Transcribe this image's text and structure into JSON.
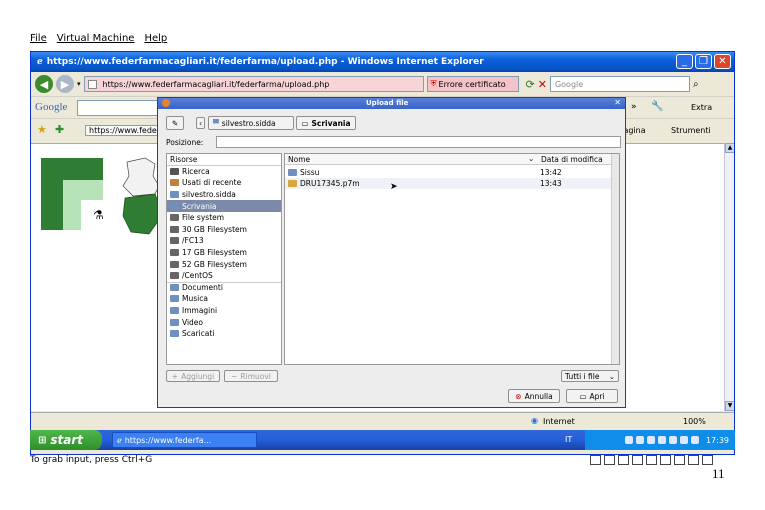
{
  "vm_menu": [
    "File",
    "Virtual Machine",
    "Help"
  ],
  "ie": {
    "title": "https://www.federfarmacagliari.it/federfarma/upload.php - Windows Internet Explorer",
    "address": "https://www.federfarmacagliari.it/federfarma/upload.php",
    "cert_error": "Errore certificato",
    "search_placeholder": "Google",
    "google_label": "Google",
    "tools_label": "Pagina",
    "tools2_label": "Strumenti",
    "extra_label": "Extra",
    "fav_tab": "https://www.fede...",
    "status_internet": "Internet",
    "zoom": "100%"
  },
  "dialog": {
    "title": "Upload file",
    "path_parent": "silvestro.sidda",
    "path_current": "Scrivania",
    "location_label": "Posizione:",
    "places_header": "Risorse",
    "places": [
      {
        "label": "Ricerca",
        "icon": "search-icon",
        "color": "#555555"
      },
      {
        "label": "Usati di recente",
        "icon": "recent-icon",
        "color": "#c08040"
      },
      {
        "label": "silvestro.sidda",
        "icon": "home-folder-icon",
        "color": "#6f8fbf"
      },
      {
        "label": "Scrivania",
        "icon": "desktop-icon",
        "color": "#6f8fbf"
      },
      {
        "label": "File system",
        "icon": "drive-icon",
        "color": "#666666"
      },
      {
        "label": "30 GB Filesystem",
        "icon": "drive-icon",
        "color": "#666666"
      },
      {
        "label": "/FC13",
        "icon": "drive-icon",
        "color": "#666666"
      },
      {
        "label": "17 GB Filesystem",
        "icon": "drive-icon",
        "color": "#666666"
      },
      {
        "label": "52 GB Filesystem",
        "icon": "drive-icon",
        "color": "#666666"
      },
      {
        "label": "/CentOS",
        "icon": "drive-icon",
        "color": "#666666"
      },
      {
        "label": "Documenti",
        "icon": "folder-icon",
        "color": "#6f8fbf"
      },
      {
        "label": "Musica",
        "icon": "folder-icon",
        "color": "#6f8fbf"
      },
      {
        "label": "Immagini",
        "icon": "folder-icon",
        "color": "#6f8fbf"
      },
      {
        "label": "Video",
        "icon": "folder-icon",
        "color": "#6f8fbf"
      },
      {
        "label": "Scaricati",
        "icon": "folder-icon",
        "color": "#6f8fbf"
      }
    ],
    "selected_place": "Scrivania",
    "col_name": "Nome",
    "col_date": "Data di modifica",
    "files": [
      {
        "name": "Sissu",
        "date": "13:42",
        "type": "folder"
      },
      {
        "name": "DRU17345.p7m",
        "date": "13:43",
        "type": "file"
      }
    ],
    "add_button": "Aggiungi",
    "remove_button": "Rimuovi",
    "filter": "Tutti i file",
    "cancel_button": "Annulla",
    "open_button": "Apri"
  },
  "taskbar": {
    "start": "start",
    "task": "https://www.federfa...",
    "lang": "IT",
    "clock": "17:39"
  },
  "vm_status": "To grab input, press Ctrl+G",
  "page_number": "11"
}
